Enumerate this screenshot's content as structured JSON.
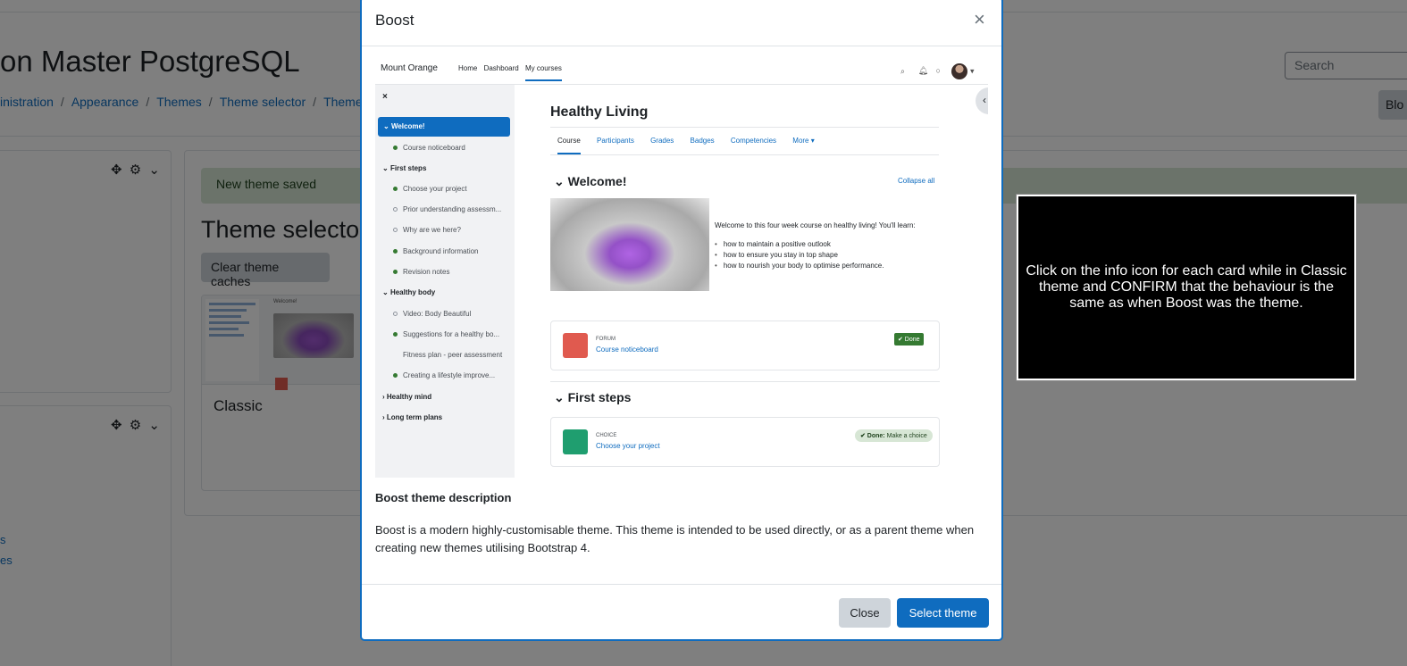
{
  "page": {
    "title": "on Master PostgreSQL",
    "search_placeholder": "Search",
    "block_button": "Blo",
    "breadcrumb": [
      "inistration",
      "Appearance",
      "Themes",
      "Theme selector",
      "Theme se"
    ],
    "block_controls": "✥ ⚙ ⌄",
    "side_links": [
      "s",
      "es"
    ],
    "alert": "New theme saved",
    "section_title": "Theme selecto",
    "clear_caches": "Clear theme caches",
    "theme_card_name": "Classic",
    "thumb_label": "Welcome!"
  },
  "modal": {
    "title": "Boost",
    "close_icon": "×",
    "description_heading": "Boost theme description",
    "description": "Boost is a modern highly-customisable theme. This theme is intended to be used directly, or as a parent theme when creating new themes utilising Bootstrap 4.",
    "close_button": "Close",
    "select_button": "Select theme"
  },
  "preview": {
    "brand": "Mount Orange",
    "nav_links": [
      "Home",
      "Dashboard",
      "My courses"
    ],
    "drawer": {
      "close": "×",
      "items": [
        {
          "label": "Welcome!",
          "kind": "active"
        },
        {
          "label": "Course noticeboard",
          "kind": "done"
        },
        {
          "label": "First steps",
          "kind": "section"
        },
        {
          "label": "Choose your project",
          "kind": "done"
        },
        {
          "label": "Prior understanding assessm...",
          "kind": "todo"
        },
        {
          "label": "Why are we here?",
          "kind": "todo"
        },
        {
          "label": "Background information",
          "kind": "done"
        },
        {
          "label": "Revision notes",
          "kind": "done"
        },
        {
          "label": "Healthy body",
          "kind": "section"
        },
        {
          "label": "Video: Body Beautiful",
          "kind": "todo"
        },
        {
          "label": "Suggestions for a healthy bo...",
          "kind": "done"
        },
        {
          "label": "Fitness plan - peer assessment",
          "kind": "none"
        },
        {
          "label": "Creating a lifestyle improve...",
          "kind": "done"
        },
        {
          "label": "Healthy mind",
          "kind": "collapsed"
        },
        {
          "label": "Long term plans",
          "kind": "collapsed"
        }
      ]
    },
    "course_title": "Healthy Living",
    "tabs": [
      "Course",
      "Participants",
      "Grades",
      "Badges",
      "Competencies",
      "More ▾"
    ],
    "welcome_heading": "Welcome!",
    "collapse_all": "Collapse all",
    "welcome_text": "Welcome to this four week course on healthy living! You'll learn:",
    "welcome_list": [
      "how to maintain a positive outlook",
      "how to ensure you stay in top shape",
      "how to nourish your body to optimise performance."
    ],
    "forum": {
      "type": "FORUM",
      "name": "Course noticeboard",
      "status": "✔ Done"
    },
    "first_steps_heading": "First steps",
    "choice": {
      "type": "CHOICE",
      "name": "Choose your project",
      "status_bold": "✔ Done:",
      "status_rest": "Make a choice"
    }
  },
  "instruction": "Click on the info icon for each card while in Classic theme and CONFIRM that the behaviour is the same as when Boost was the theme.",
  "colors": {
    "accent": "#0f6cbf",
    "success": "#357a32",
    "forum": "#e05a4f",
    "choice": "#1f9e6f"
  }
}
